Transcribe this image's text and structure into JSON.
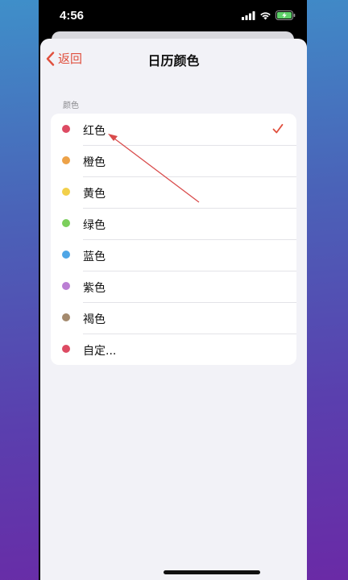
{
  "status_bar": {
    "time": "4:56",
    "icons": [
      "cellular-signal-icon",
      "wifi-icon",
      "battery-charging-icon"
    ]
  },
  "nav": {
    "back_label": "返回",
    "back_icon": "chevron-left-icon",
    "title": "日历颜色",
    "accent_color": "#e0503e"
  },
  "section": {
    "header": "颜色"
  },
  "colors": [
    {
      "label": "红色",
      "color": "#dd4b63",
      "selected": true
    },
    {
      "label": "橙色",
      "color": "#eda248",
      "selected": false
    },
    {
      "label": "黄色",
      "color": "#f2d04b",
      "selected": false
    },
    {
      "label": "绿色",
      "color": "#7ccf5c",
      "selected": false
    },
    {
      "label": "蓝色",
      "color": "#4fa6e6",
      "selected": false
    },
    {
      "label": "紫色",
      "color": "#bb7fd4",
      "selected": false
    },
    {
      "label": "褐色",
      "color": "#a48a6e",
      "selected": false
    },
    {
      "label": "自定...",
      "color": "#dd4b63",
      "selected": false
    }
  ],
  "annotation": {
    "type": "arrow",
    "color": "#d94b4b",
    "points_to": "红色"
  }
}
